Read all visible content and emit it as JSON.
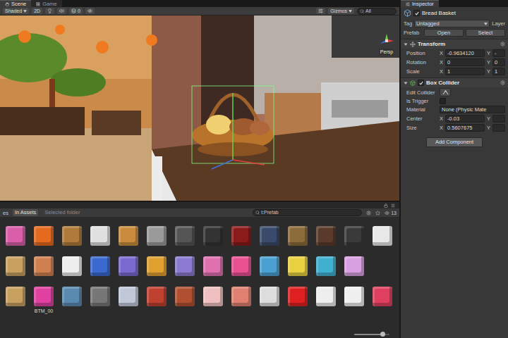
{
  "scene_tabs": [
    {
      "label": "Scene",
      "selected": true
    },
    {
      "label": "Game",
      "selected": false
    }
  ],
  "scene_toolbar": {
    "shading": "Shaded",
    "mode_2d": "2D",
    "mode_2d_on": false,
    "effects_count": "0",
    "gizmos": "Gizmos",
    "search": "All"
  },
  "viewport": {
    "projection": "Persp"
  },
  "project": {
    "folder": "es",
    "filters": [
      {
        "label": "In Assets",
        "selected": true
      },
      {
        "label": "Selected folder",
        "selected": false
      }
    ],
    "search": "t:Prefab",
    "count": "13",
    "zoom": 0.8,
    "assets": [
      [
        {
          "color": "#d85fa8"
        },
        {
          "color": "#e46a1f"
        },
        {
          "color": "#b07a3a"
        },
        {
          "color": "#e0e0e0"
        },
        {
          "color": "#c98c3c"
        },
        {
          "color": "#9a9a9a"
        },
        {
          "color": "#555555"
        },
        {
          "color": "#333333"
        },
        {
          "color": "#8b1a1a"
        },
        {
          "color": "#3a4a6a"
        },
        {
          "color": "#8b6b3a"
        },
        {
          "color": "#5a3a2a"
        },
        {
          "color": "#3a3a3a"
        },
        {
          "color": "#e8e8e8"
        }
      ],
      [
        {
          "color": "#c9a060"
        },
        {
          "color": "#d08050"
        },
        {
          "color": "#eeeeee"
        },
        {
          "color": "#3a6ad0"
        },
        {
          "color": "#7a6ad0"
        },
        {
          "color": "#e0a030"
        },
        {
          "color": "#8a7ad0"
        },
        {
          "color": "#e070b0"
        },
        {
          "color": "#e85090"
        },
        {
          "color": "#4aa0d0"
        },
        {
          "color": "#e8d040"
        },
        {
          "color": "#40b0d0"
        },
        {
          "color": "#d8a0e0"
        }
      ],
      [
        {
          "color": "#c8a060"
        },
        {
          "color": "#e040a0",
          "label": "BTM_00"
        },
        {
          "color": "#5a8ab0"
        },
        {
          "color": "#777777"
        },
        {
          "color": "#c0c8d8"
        },
        {
          "color": "#c04030"
        },
        {
          "color": "#b05030"
        },
        {
          "color": "#f0c0c0"
        },
        {
          "color": "#e08070"
        },
        {
          "color": "#dddddd"
        },
        {
          "color": "#e02020"
        },
        {
          "color": "#eeeeee"
        },
        {
          "color": "#f0f0f0"
        },
        {
          "color": "#e04060"
        }
      ]
    ]
  },
  "inspector": {
    "tab": {
      "label": "Inspector",
      "selected": true
    },
    "object": {
      "name": "Bread Basket",
      "active": true,
      "tag_label": "Tag",
      "tag": "Untagged",
      "layer_label": "Layer",
      "prefab_label": "Prefab",
      "prefab_buttons": [
        "Open",
        "Select"
      ]
    },
    "components": [
      {
        "name": "Transform",
        "kind": "transform",
        "expanded": true,
        "rows": [
          {
            "label": "Position",
            "kind": "vector",
            "fields": [
              {
                "axis": "X",
                "value": "-0.9634120"
              },
              {
                "axis": "Y",
                "value": "-"
              }
            ]
          },
          {
            "label": "Rotation",
            "kind": "vector",
            "fields": [
              {
                "axis": "X",
                "value": "0"
              },
              {
                "axis": "Y",
                "value": "0"
              }
            ]
          },
          {
            "label": "Scale",
            "kind": "vector",
            "fields": [
              {
                "axis": "X",
                "value": "1"
              },
              {
                "axis": "Y",
                "value": "1"
              }
            ]
          }
        ]
      },
      {
        "name": "Box Collider",
        "kind": "collider",
        "expanded": true,
        "enabled": true,
        "rows": [
          {
            "label": "Edit Collider",
            "kind": "button"
          },
          {
            "label": "Is Trigger",
            "kind": "checkbox",
            "checked": false
          },
          {
            "label": "Material",
            "kind": "object",
            "value": "None (Physic Mate"
          },
          {
            "label": "Center",
            "kind": "vector",
            "fields": [
              {
                "axis": "X",
                "value": "-0.03"
              },
              {
                "axis": "Y"
              }
            ]
          },
          {
            "label": "Size",
            "kind": "vector",
            "fields": [
              {
                "axis": "X",
                "value": "0.5607675"
              },
              {
                "axis": "Y"
              }
            ]
          }
        ]
      }
    ],
    "add_component": "Add Component"
  }
}
